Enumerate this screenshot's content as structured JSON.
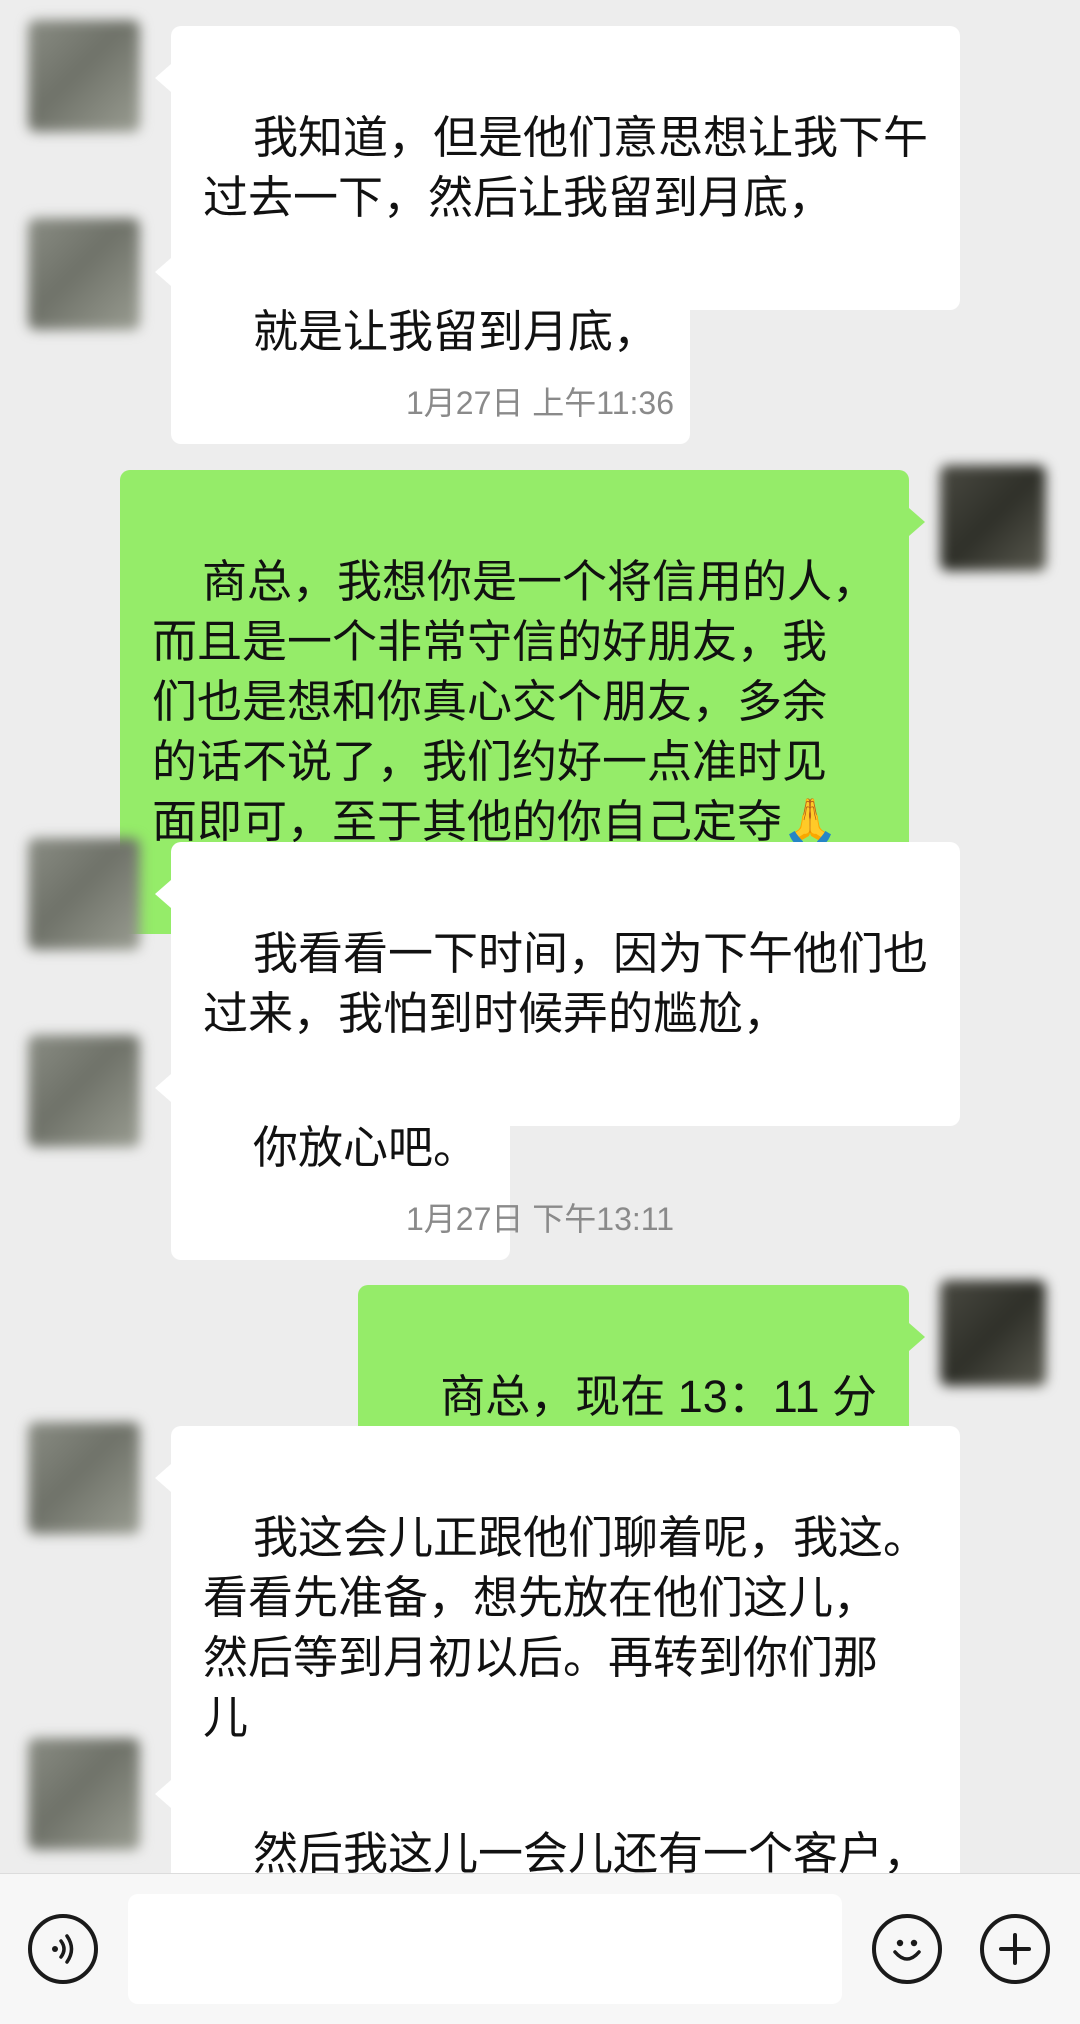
{
  "messages": [
    {
      "side": "recv",
      "text": "我知道，但是他们意思想让我下午\n过去一下，然后让我留到月底，"
    },
    {
      "side": "recv",
      "text": "就是让我留到月底，"
    },
    {
      "timestamp": "1月27日 上午11:36"
    },
    {
      "side": "sent",
      "text": "商总，我想你是一个将信用的人，\n而且是一个非常守信的好朋友，我\n们也是想和你真心交个朋友，多余\n的话不说了，我们约好一点准时见\n面即可，至于其他的你自己定夺",
      "emoji": "🙏"
    },
    {
      "side": "recv",
      "text": "我看看一下时间，因为下午他们也\n过来，我怕到时候弄的尴尬，"
    },
    {
      "side": "recv",
      "text": "你放心吧。"
    },
    {
      "timestamp": "1月27日 下午13:11"
    },
    {
      "side": "sent",
      "text": "商总，现在 13：11 分"
    },
    {
      "side": "recv",
      "text": "我这会儿正跟他们聊着呢，我这。\n看看先准备，想先放在他们这儿，\n然后等到月初以后。再转到你们那\n儿"
    },
    {
      "side": "recv",
      "text": "然后我这儿一会儿还有一个客户，\n然后呢，他一会儿要过来，这这两"
    }
  ],
  "input_bar": {
    "voice_icon": "voice-wave-icon",
    "emoji_icon": "smiley-icon",
    "plus_icon": "plus-icon"
  },
  "colors": {
    "background": "#ededed",
    "sent_bubble": "#95ec69",
    "received_bubble": "#ffffff",
    "timestamp_text": "#8a8a8a"
  }
}
